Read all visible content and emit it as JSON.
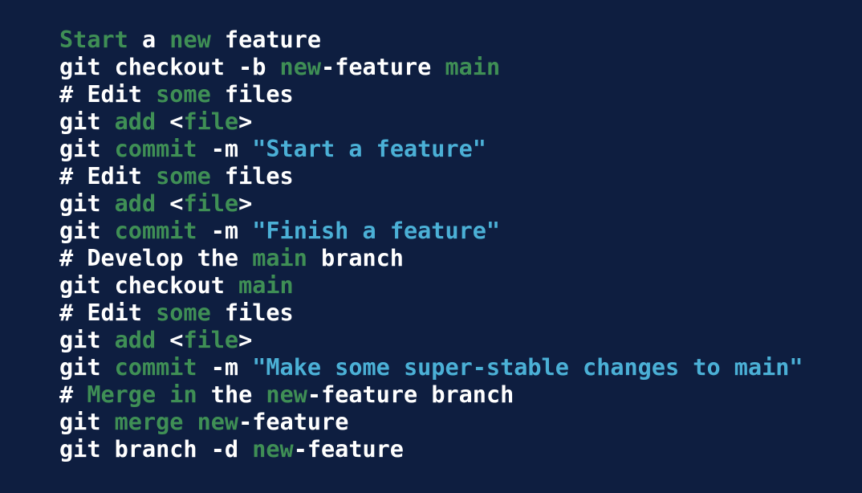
{
  "colors": {
    "background": "#0e1e40",
    "plain": "#ffffff",
    "keyword": "#3f8f55",
    "string": "#4bb0d6"
  },
  "code": {
    "lines": [
      [
        {
          "text": "Start",
          "kind": "kw"
        },
        {
          "text": " a ",
          "kind": "plain"
        },
        {
          "text": "new",
          "kind": "kw"
        },
        {
          "text": " feature",
          "kind": "plain"
        }
      ],
      [
        {
          "text": "git checkout -b ",
          "kind": "plain"
        },
        {
          "text": "new",
          "kind": "kw"
        },
        {
          "text": "-feature ",
          "kind": "plain"
        },
        {
          "text": "main",
          "kind": "kw"
        }
      ],
      [
        {
          "text": "# Edit ",
          "kind": "plain"
        },
        {
          "text": "some",
          "kind": "kw"
        },
        {
          "text": " files",
          "kind": "plain"
        }
      ],
      [
        {
          "text": "git ",
          "kind": "plain"
        },
        {
          "text": "add",
          "kind": "kw"
        },
        {
          "text": " <",
          "kind": "plain"
        },
        {
          "text": "file",
          "kind": "kw"
        },
        {
          "text": ">",
          "kind": "plain"
        }
      ],
      [
        {
          "text": "git ",
          "kind": "plain"
        },
        {
          "text": "commit",
          "kind": "kw"
        },
        {
          "text": " -m ",
          "kind": "plain"
        },
        {
          "text": "\"Start a feature\"",
          "kind": "str"
        }
      ],
      [
        {
          "text": "# Edit ",
          "kind": "plain"
        },
        {
          "text": "some",
          "kind": "kw"
        },
        {
          "text": " files",
          "kind": "plain"
        }
      ],
      [
        {
          "text": "git ",
          "kind": "plain"
        },
        {
          "text": "add",
          "kind": "kw"
        },
        {
          "text": " <",
          "kind": "plain"
        },
        {
          "text": "file",
          "kind": "kw"
        },
        {
          "text": ">",
          "kind": "plain"
        }
      ],
      [
        {
          "text": "git ",
          "kind": "plain"
        },
        {
          "text": "commit",
          "kind": "kw"
        },
        {
          "text": " -m ",
          "kind": "plain"
        },
        {
          "text": "\"Finish a feature\"",
          "kind": "str"
        }
      ],
      [
        {
          "text": "# Develop the ",
          "kind": "plain"
        },
        {
          "text": "main",
          "kind": "kw"
        },
        {
          "text": " branch",
          "kind": "plain"
        }
      ],
      [
        {
          "text": "git checkout ",
          "kind": "plain"
        },
        {
          "text": "main",
          "kind": "kw"
        }
      ],
      [
        {
          "text": "# Edit ",
          "kind": "plain"
        },
        {
          "text": "some",
          "kind": "kw"
        },
        {
          "text": " files",
          "kind": "plain"
        }
      ],
      [
        {
          "text": "git ",
          "kind": "plain"
        },
        {
          "text": "add",
          "kind": "kw"
        },
        {
          "text": " <",
          "kind": "plain"
        },
        {
          "text": "file",
          "kind": "kw"
        },
        {
          "text": ">",
          "kind": "plain"
        }
      ],
      [
        {
          "text": "git ",
          "kind": "plain"
        },
        {
          "text": "commit",
          "kind": "kw"
        },
        {
          "text": " -m ",
          "kind": "plain"
        },
        {
          "text": "\"Make some super-stable changes to main\"",
          "kind": "str"
        }
      ],
      [
        {
          "text": "# ",
          "kind": "plain"
        },
        {
          "text": "Merge",
          "kind": "kw"
        },
        {
          "text": " ",
          "kind": "plain"
        },
        {
          "text": "in",
          "kind": "kw"
        },
        {
          "text": " the ",
          "kind": "plain"
        },
        {
          "text": "new",
          "kind": "kw"
        },
        {
          "text": "-feature branch",
          "kind": "plain"
        }
      ],
      [
        {
          "text": "git ",
          "kind": "plain"
        },
        {
          "text": "merge",
          "kind": "kw"
        },
        {
          "text": " ",
          "kind": "plain"
        },
        {
          "text": "new",
          "kind": "kw"
        },
        {
          "text": "-feature",
          "kind": "plain"
        }
      ],
      [
        {
          "text": "git branch -d ",
          "kind": "plain"
        },
        {
          "text": "new",
          "kind": "kw"
        },
        {
          "text": "-feature",
          "kind": "plain"
        }
      ]
    ]
  }
}
